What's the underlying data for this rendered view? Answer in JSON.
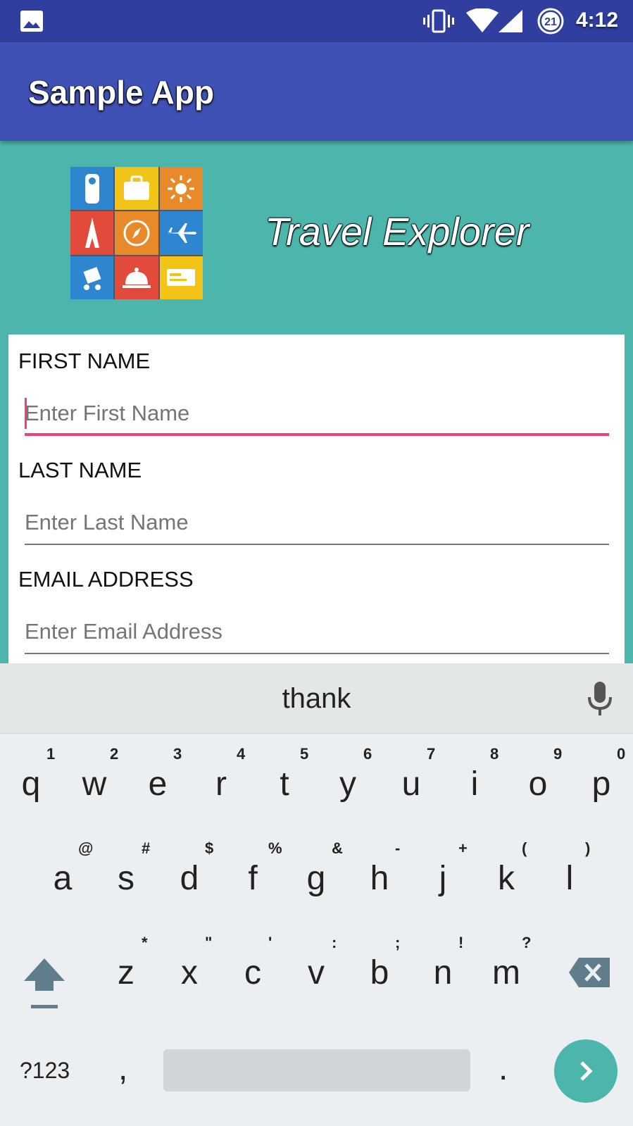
{
  "status_bar": {
    "time": "4:12",
    "battery_level": "21",
    "icons": [
      "image-icon",
      "vibrate-icon",
      "wifi-icon",
      "cell-signal-icon",
      "battery-icon"
    ]
  },
  "app_bar": {
    "title": "Sample App"
  },
  "brand": {
    "name": "Travel Explorer"
  },
  "form": {
    "first_name": {
      "label": "FIRST NAME",
      "placeholder": "Enter First Name"
    },
    "last_name": {
      "label": "LAST NAME",
      "placeholder": "Enter Last Name"
    },
    "email": {
      "label": "EMAIL ADDRESS",
      "placeholder": "Enter Email Address"
    }
  },
  "keyboard": {
    "suggestion": "thank",
    "row1": [
      {
        "key": "q",
        "hint": "1"
      },
      {
        "key": "w",
        "hint": "2"
      },
      {
        "key": "e",
        "hint": "3"
      },
      {
        "key": "r",
        "hint": "4"
      },
      {
        "key": "t",
        "hint": "5"
      },
      {
        "key": "y",
        "hint": "6"
      },
      {
        "key": "u",
        "hint": "7"
      },
      {
        "key": "i",
        "hint": "8"
      },
      {
        "key": "o",
        "hint": "9"
      },
      {
        "key": "p",
        "hint": "0"
      }
    ],
    "row2": [
      {
        "key": "a",
        "hint": "@"
      },
      {
        "key": "s",
        "hint": "#"
      },
      {
        "key": "d",
        "hint": "$"
      },
      {
        "key": "f",
        "hint": "%"
      },
      {
        "key": "g",
        "hint": "&"
      },
      {
        "key": "h",
        "hint": "-"
      },
      {
        "key": "j",
        "hint": "+"
      },
      {
        "key": "k",
        "hint": "("
      },
      {
        "key": "l",
        "hint": ")"
      }
    ],
    "row3": [
      {
        "key": "z",
        "hint": "*"
      },
      {
        "key": "x",
        "hint": "\""
      },
      {
        "key": "c",
        "hint": "'"
      },
      {
        "key": "v",
        "hint": ":"
      },
      {
        "key": "b",
        "hint": ";"
      },
      {
        "key": "n",
        "hint": "!"
      },
      {
        "key": "m",
        "hint": "?"
      }
    ],
    "symbols_label": "?123",
    "comma_label": ",",
    "period_label": "."
  },
  "colors": {
    "status_bar": "#303F9F",
    "app_bar": "#3F51B5",
    "background": "#4DB6AC",
    "accent": "#F0407A"
  }
}
